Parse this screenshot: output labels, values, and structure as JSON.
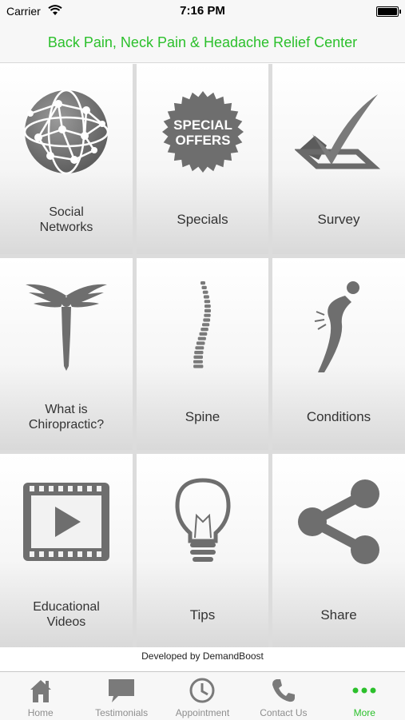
{
  "status_bar": {
    "carrier": "Carrier",
    "time": "7:16 PM"
  },
  "header": {
    "title": "Back Pain, Neck Pain & Headache Relief Center"
  },
  "tiles": [
    {
      "label_line1": "Social",
      "label_line2": "Networks",
      "icon": "globe-network-icon"
    },
    {
      "label": "Specials",
      "icon": "special-offers-badge-icon",
      "badge_line1": "SPECIAL",
      "badge_line2": "OFFERS"
    },
    {
      "label": "Survey",
      "icon": "checkmark-icon"
    },
    {
      "label_line1": "What is",
      "label_line2": "Chiropractic?",
      "icon": "winged-figure-icon"
    },
    {
      "label": "Spine",
      "icon": "spine-icon"
    },
    {
      "label": "Conditions",
      "icon": "back-pain-figure-icon"
    },
    {
      "label_line1": "Educational",
      "label_line2": "Videos",
      "icon": "video-play-icon"
    },
    {
      "label": "Tips",
      "icon": "lightbulb-icon"
    },
    {
      "label": "Share",
      "icon": "share-icon"
    }
  ],
  "footer": {
    "developed_by": "Developed by DemandBoost"
  },
  "tabbar": {
    "items": [
      {
        "label": "Home",
        "icon": "home-icon"
      },
      {
        "label": "Testimonials",
        "icon": "chat-bubble-icon"
      },
      {
        "label": "Appointment",
        "icon": "clock-icon"
      },
      {
        "label": "Contact Us",
        "icon": "phone-icon"
      },
      {
        "label": "More",
        "icon": "more-dots-icon"
      }
    ],
    "active": "More"
  },
  "colors": {
    "accent": "#2cc02c",
    "icon_gray": "#7a7a7a"
  }
}
